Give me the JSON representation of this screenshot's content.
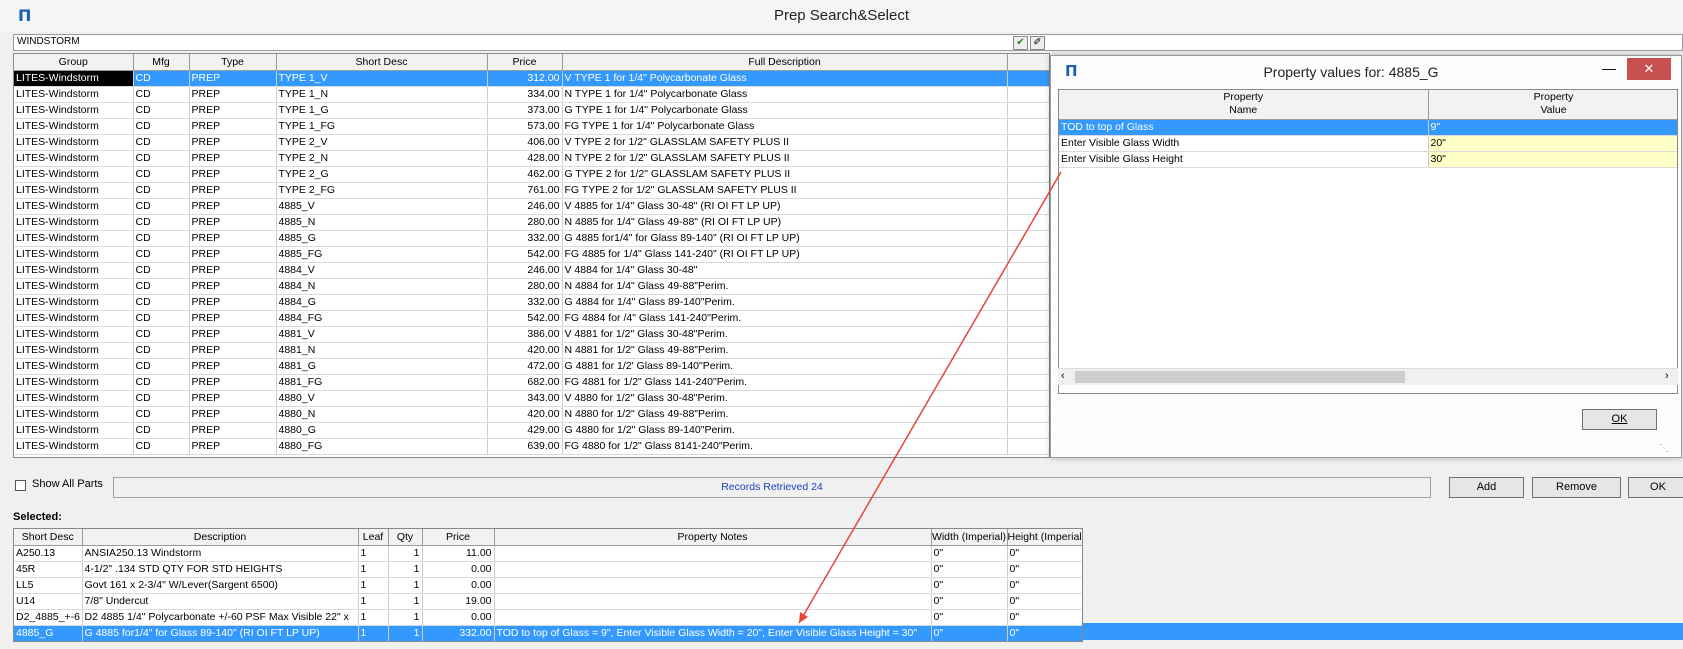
{
  "window": {
    "title": "Prep Search&Select",
    "logo": "Π"
  },
  "search": {
    "value": "WINDSTORM",
    "ok_icon": "✔",
    "erase_icon": "✐"
  },
  "top_grid": {
    "headers": [
      "Group",
      "Mfg",
      "Type",
      "Short Desc",
      "Price",
      "Full Description"
    ],
    "rows": [
      [
        "LITES-Windstorm",
        "CD",
        "PREP",
        "TYPE 1_V",
        "312.00",
        "V TYPE 1 for 1/4\" Polycarbonate Glass"
      ],
      [
        "LITES-Windstorm",
        "CD",
        "PREP",
        "TYPE 1_N",
        "334.00",
        "N TYPE 1 for 1/4\" Polycarbonate Glass"
      ],
      [
        "LITES-Windstorm",
        "CD",
        "PREP",
        "TYPE 1_G",
        "373.00",
        "G TYPE 1 for 1/4\" Polycarbonate Glass"
      ],
      [
        "LITES-Windstorm",
        "CD",
        "PREP",
        "TYPE 1_FG",
        "573.00",
        "FG TYPE 1 for 1/4\" Polycarbonate Glass"
      ],
      [
        "LITES-Windstorm",
        "CD",
        "PREP",
        "TYPE 2_V",
        "406.00",
        "V TYPE 2 for 1/2\" GLASSLAM SAFETY PLUS II"
      ],
      [
        "LITES-Windstorm",
        "CD",
        "PREP",
        "TYPE 2_N",
        "428.00",
        "N TYPE 2 for 1/2\" GLASSLAM SAFETY PLUS II"
      ],
      [
        "LITES-Windstorm",
        "CD",
        "PREP",
        "TYPE 2_G",
        "462.00",
        "G TYPE 2 for 1/2\" GLASSLAM SAFETY PLUS II"
      ],
      [
        "LITES-Windstorm",
        "CD",
        "PREP",
        "TYPE 2_FG",
        "761.00",
        "FG TYPE 2 for 1/2\" GLASSLAM SAFETY PLUS II"
      ],
      [
        "LITES-Windstorm",
        "CD",
        "PREP",
        "4885_V",
        "246.00",
        "V 4885 for 1/4\" Glass 30-48\" (RI OI FT LP UP)"
      ],
      [
        "LITES-Windstorm",
        "CD",
        "PREP",
        "4885_N",
        "280.00",
        "N 4885 for 1/4\" Glass 49-88\" (RI OI FT LP UP)"
      ],
      [
        "LITES-Windstorm",
        "CD",
        "PREP",
        "4885_G",
        "332.00",
        "G 4885 for1/4\" for Glass 89-140\" (RI OI FT LP UP)"
      ],
      [
        "LITES-Windstorm",
        "CD",
        "PREP",
        "4885_FG",
        "542.00",
        "FG 4885 for 1/4\" Glass 141-240\" (RI OI FT LP UP)"
      ],
      [
        "LITES-Windstorm",
        "CD",
        "PREP",
        "4884_V",
        "246.00",
        "V 4884 for 1/4\" Glass 30-48\""
      ],
      [
        "LITES-Windstorm",
        "CD",
        "PREP",
        "4884_N",
        "280.00",
        "N 4884 for 1/4\" Glass 49-88\"Perim."
      ],
      [
        "LITES-Windstorm",
        "CD",
        "PREP",
        "4884_G",
        "332.00",
        "G 4884 for 1/4\" Glass 89-140\"Perim."
      ],
      [
        "LITES-Windstorm",
        "CD",
        "PREP",
        "4884_FG",
        "542.00",
        "FG 4884 for /4\" Glass 141-240\"Perim."
      ],
      [
        "LITES-Windstorm",
        "CD",
        "PREP",
        "4881_V",
        "386.00",
        "V 4881 for 1/2\" Glass 30-48\"Perim."
      ],
      [
        "LITES-Windstorm",
        "CD",
        "PREP",
        "4881_N",
        "420.00",
        "N 4881 for 1/2\" Glass 49-88\"Perim."
      ],
      [
        "LITES-Windstorm",
        "CD",
        "PREP",
        "4881_G",
        "472.00",
        "G 4881 for 1/2' Glass 89-140\"Perim."
      ],
      [
        "LITES-Windstorm",
        "CD",
        "PREP",
        "4881_FG",
        "682.00",
        "FG 4881 for 1/2\" Glass 141-240\"Perim."
      ],
      [
        "LITES-Windstorm",
        "CD",
        "PREP",
        "4880_V",
        "343.00",
        "V 4880 for 1/2\" Glass 30-48\"Perim."
      ],
      [
        "LITES-Windstorm",
        "CD",
        "PREP",
        "4880_N",
        "420.00",
        "N 4880 for 1/2\" Glass 49-88\"Perim."
      ],
      [
        "LITES-Windstorm",
        "CD",
        "PREP",
        "4880_G",
        "429.00",
        "G 4880 for 1/2\" Glass 89-140\"Perim."
      ],
      [
        "LITES-Windstorm",
        "CD",
        "PREP",
        "4880_FG",
        "639.00",
        "FG 4880 for 1/2\" Glass 8141-240\"Perim."
      ]
    ]
  },
  "dialog": {
    "title": "Property values for: 4885_G",
    "min_icon": "—",
    "close_icon": "✕",
    "header_name_1": "Property",
    "header_name_2": "Name",
    "header_value_1": "Property",
    "header_value_2": "Value",
    "rows": [
      [
        "TOD to top of Glass",
        "9\""
      ],
      [
        "Enter Visible Glass Width",
        "20\""
      ],
      [
        "Enter Visible Glass Height",
        "30\""
      ]
    ],
    "ok_label": "OK"
  },
  "controls": {
    "show_all_parts": "Show All Parts",
    "status": "Records Retrieved 24",
    "add": "Add",
    "remove": "Remove",
    "ok": "OK",
    "selected_label": "Selected:"
  },
  "selected_grid": {
    "headers": [
      "Short Desc",
      "Description",
      "Leaf",
      "Qty",
      "Price",
      "Property Notes",
      "Width (Imperial)",
      "Height (Imperial)"
    ],
    "rows": [
      [
        "A250.13",
        "ANSIA250.13 Windstorm",
        "1",
        "1",
        "11.00",
        "",
        "0\"",
        "0\""
      ],
      [
        "45R",
        "4-1/2\" .134 STD QTY FOR STD HEIGHTS",
        "1",
        "1",
        "0.00",
        "",
        "0\"",
        "0\""
      ],
      [
        "LL5",
        "Govt 161 x 2-3/4\" W/Lever(Sargent 6500)",
        "1",
        "1",
        "0.00",
        "",
        "0\"",
        "0\""
      ],
      [
        "U14",
        "7/8\" Undercut",
        "1",
        "1",
        "19.00",
        "",
        "0\"",
        "0\""
      ],
      [
        "D2_4885_+-6",
        "D2 4885 1/4\" Polycarbonate +/-60 PSF Max Visible 22\" x",
        "1",
        "1",
        "0.00",
        "",
        "0\"",
        "0\""
      ],
      [
        "4885_G",
        "G 4885 for1/4\" for Glass 89-140\" (RI OI FT LP UP)",
        "1",
        "1",
        "332.00",
        "TOD to top of Glass = 9\", Enter Visible Glass Width = 20\", Enter Visible Glass Height = 30\"",
        "0\"",
        "0\""
      ]
    ]
  },
  "accent": "#3399ff",
  "arrow_color": "#e8463a"
}
